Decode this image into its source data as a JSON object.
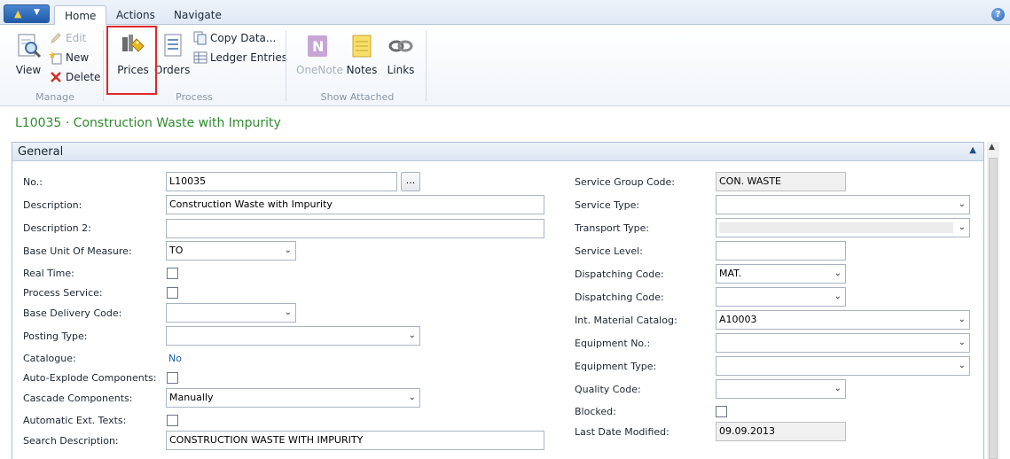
{
  "tabs": [
    "Home",
    "Actions",
    "Navigate"
  ],
  "help_icon": "question-icon",
  "ribbon": {
    "manage": {
      "label": "Manage",
      "view": "View",
      "edit": "Edit",
      "new": "New",
      "delete": "Delete"
    },
    "process": {
      "label": "Process",
      "prices": "Prices",
      "orders": "Orders",
      "copy_data": "Copy Data...",
      "ledger_entries": "Ledger Entries"
    },
    "show_attached": {
      "label": "Show Attached",
      "onenote": "OneNote",
      "notes": "Notes",
      "links": "Links"
    }
  },
  "page_title": "L10035 · Construction Waste with Impurity",
  "fasttab": {
    "title": "General"
  },
  "left": {
    "no": {
      "label": "No.:",
      "value": "L10035"
    },
    "description": {
      "label": "Description:",
      "value": "Construction Waste with Impurity"
    },
    "description2": {
      "label": "Description 2:",
      "value": ""
    },
    "base_uom": {
      "label": "Base Unit Of Measure:",
      "value": "TO"
    },
    "real_time": {
      "label": "Real Time:"
    },
    "process_service": {
      "label": "Process Service:"
    },
    "base_delivery_code": {
      "label": "Base Delivery Code:",
      "value": ""
    },
    "posting_type": {
      "label": "Posting Type:",
      "value": ""
    },
    "catalogue": {
      "label": "Catalogue:",
      "value": "No"
    },
    "auto_explode": {
      "label": "Auto-Explode Components:"
    },
    "cascade_components": {
      "label": "Cascade Components:",
      "value": "Manually"
    },
    "automatic_ext_texts": {
      "label": "Automatic Ext. Texts:"
    },
    "search_description": {
      "label": "Search Description:",
      "value": "CONSTRUCTION WASTE WITH IMPURITY"
    }
  },
  "right": {
    "service_group_code": {
      "label": "Service Group Code:",
      "value": "CON. WASTE"
    },
    "service_type": {
      "label": "Service Type:",
      "value": ""
    },
    "transport_type": {
      "label": "Transport Type:",
      "value": ""
    },
    "service_level": {
      "label": "Service Level:",
      "value": ""
    },
    "dispatching_code1": {
      "label": "Dispatching Code:",
      "value": "MAT."
    },
    "dispatching_code2": {
      "label": "Dispatching Code:",
      "value": ""
    },
    "int_material_catalog": {
      "label": "Int. Material Catalog:",
      "value": "A10003"
    },
    "equipment_no": {
      "label": "Equipment No.:",
      "value": ""
    },
    "equipment_type": {
      "label": "Equipment Type:",
      "value": ""
    },
    "quality_code": {
      "label": "Quality Code:",
      "value": ""
    },
    "blocked": {
      "label": "Blocked:"
    },
    "last_date_modified": {
      "label": "Last Date Modified:",
      "value": "09.09.2013"
    }
  }
}
